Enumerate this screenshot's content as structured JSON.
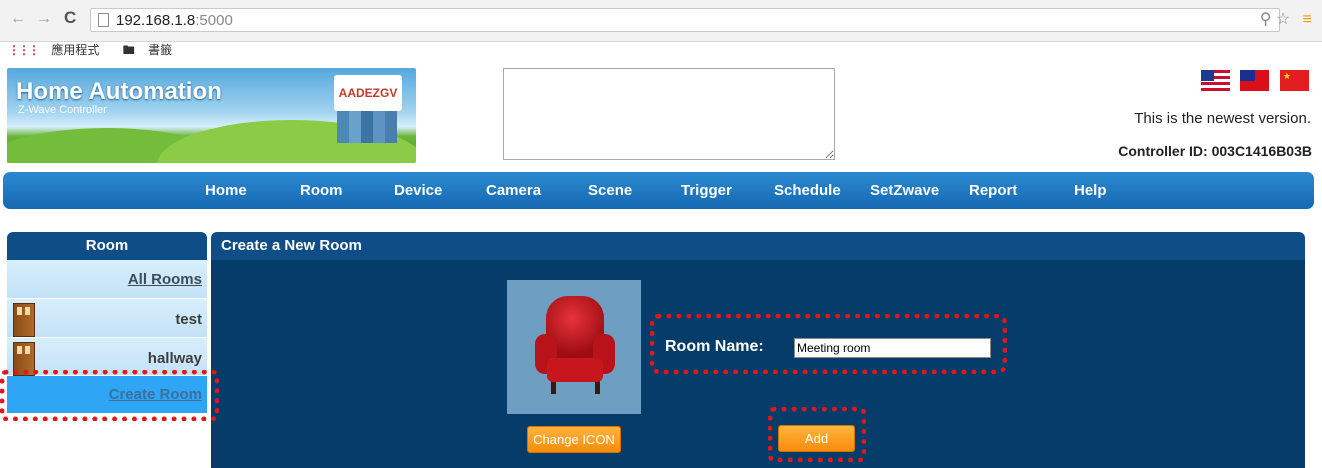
{
  "browser": {
    "url_host": "192.168.1.8",
    "url_port": ":5000",
    "bookmarks": [
      "應用程式",
      "書籤"
    ]
  },
  "header": {
    "title": "Home Automation",
    "subtitle": "Z-Wave Controller",
    "logo_text": "AADEZGV",
    "version_text": "This is the newest version.",
    "controller_id": "Controller ID: 003C1416B03B"
  },
  "nav": [
    "Home",
    "Room",
    "Device",
    "Camera",
    "Scene",
    "Trigger",
    "Schedule",
    "SetZwave",
    "Report",
    "Help"
  ],
  "sidebar": {
    "title": "Room",
    "all_rooms": "All Rooms",
    "rooms": [
      "test",
      "hallway"
    ],
    "create_room": "Create Room"
  },
  "panel": {
    "title": "Create a New Room",
    "room_name_label": "Room Name:",
    "room_name_value": "Meeting room",
    "change_icon_label": "Change ICON",
    "add_label": "Add"
  },
  "colors": {
    "nav_blue": "#1a71b9",
    "panel_navy": "#063c6a",
    "button_orange": "#f99a18",
    "highlight_red": "#e01818"
  }
}
